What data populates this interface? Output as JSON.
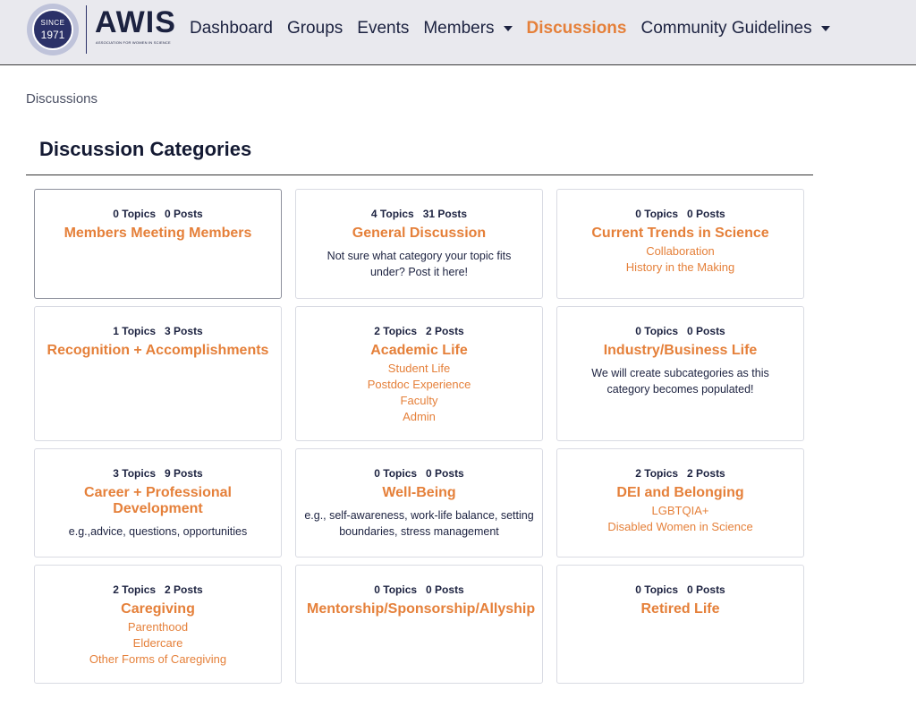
{
  "brand": {
    "seal_since": "SINCE",
    "seal_year": "1971",
    "name": "AWIS",
    "tagline": "ASSOCIATION FOR WOMEN IN SCIENCE"
  },
  "nav": {
    "dashboard": "Dashboard",
    "groups": "Groups",
    "events": "Events",
    "members": "Members",
    "discussions": "Discussions",
    "guidelines": "Community Guidelines"
  },
  "breadcrumb": "Discussions",
  "page_title": "Discussion Categories",
  "accent_color": "#e5803a",
  "categories": [
    {
      "topics": "0 Topics",
      "posts": "0 Posts",
      "title": "Members Meeting Members"
    },
    {
      "topics": "4 Topics",
      "posts": "31 Posts",
      "title": "General Discussion",
      "description": "Not sure what category your topic fits under? Post it here!"
    },
    {
      "topics": "0 Topics",
      "posts": "0 Posts",
      "title": "Current Trends in Science",
      "subs": [
        "Collaboration",
        "History in the Making"
      ]
    },
    {
      "topics": "1 Topics",
      "posts": "3 Posts",
      "title": "Recognition + Accomplishments"
    },
    {
      "topics": "2 Topics",
      "posts": "2 Posts",
      "title": "Academic Life",
      "subs": [
        "Student Life",
        "Postdoc Experience",
        "Faculty",
        "Admin"
      ]
    },
    {
      "topics": "0 Topics",
      "posts": "0 Posts",
      "title": "Industry/Business Life",
      "description": "We will create subcategories as this category becomes populated!"
    },
    {
      "topics": "3 Topics",
      "posts": "9 Posts",
      "title": "Career + Professional Development",
      "description": "e.g.,advice, questions, opportunities"
    },
    {
      "topics": "0 Topics",
      "posts": "0 Posts",
      "title": "Well-Being",
      "description": "e.g., self-awareness, work-life balance, setting boundaries, stress management"
    },
    {
      "topics": "2 Topics",
      "posts": "2 Posts",
      "title": "DEI and Belonging",
      "subs": [
        "LGBTQIA+",
        "Disabled Women in Science"
      ]
    },
    {
      "topics": "2 Topics",
      "posts": "2 Posts",
      "title": "Caregiving",
      "subs": [
        "Parenthood",
        "Eldercare",
        "Other Forms of Caregiving"
      ]
    },
    {
      "topics": "0 Topics",
      "posts": "0 Posts",
      "title": "Mentorship/Sponsorship/Allyship"
    },
    {
      "topics": "0 Topics",
      "posts": "0 Posts",
      "title": "Retired Life"
    }
  ]
}
